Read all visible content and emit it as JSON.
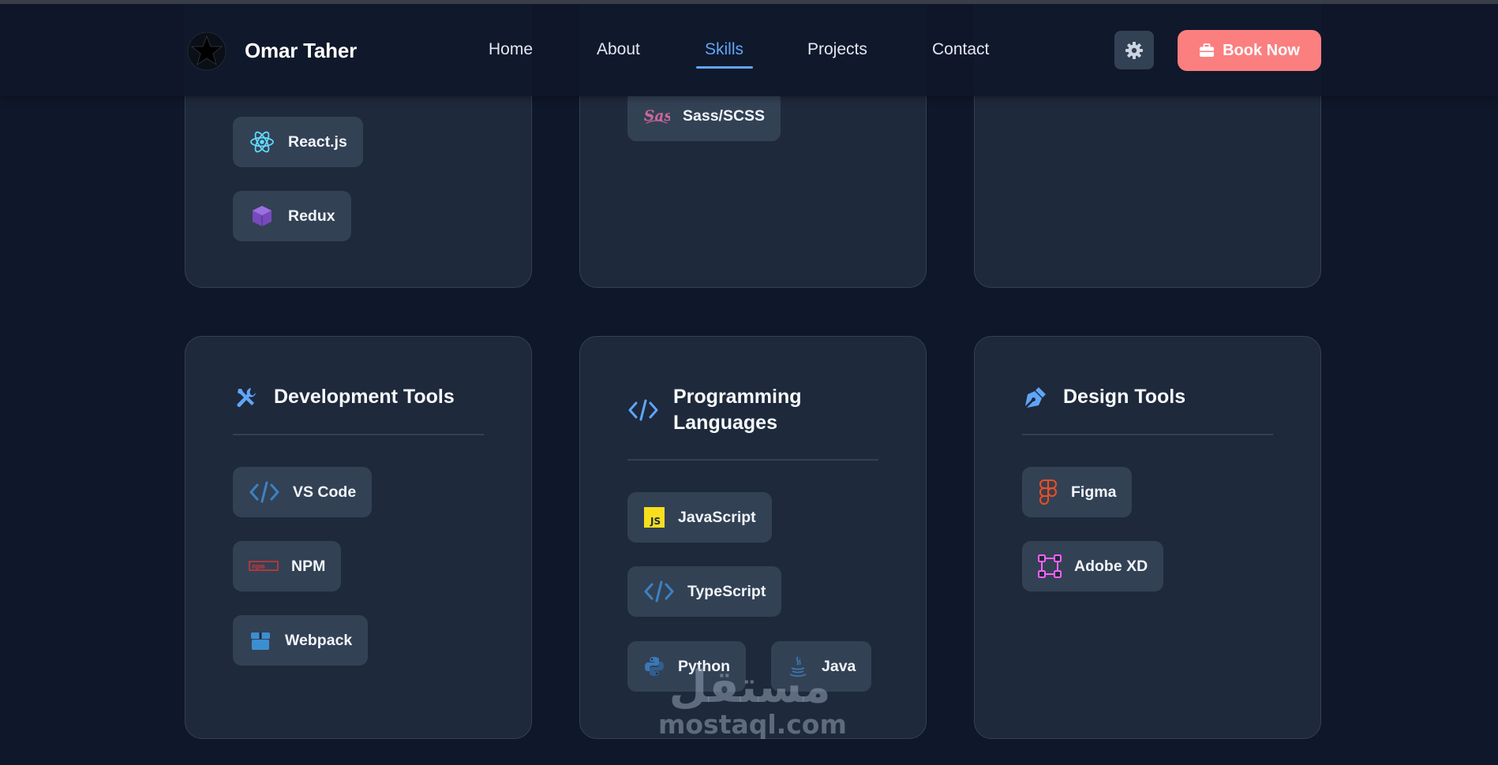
{
  "nav": {
    "brand": "Omar Taher",
    "links": [
      "Home",
      "About",
      "Skills",
      "Projects",
      "Contact"
    ],
    "active_link": "Skills",
    "theme_icon": "gear-icon",
    "book_label": "Book Now",
    "book_icon": "briefcase-icon"
  },
  "top_cards": {
    "left": {
      "skills": [
        {
          "name": "React.js",
          "icon": "react-icon"
        },
        {
          "name": "Redux",
          "icon": "redux-icon"
        }
      ]
    },
    "middle": {
      "skills": [
        {
          "name": "Sass/SCSS",
          "icon": "sass-icon"
        }
      ]
    },
    "right": {
      "skills": []
    }
  },
  "cards": [
    {
      "title": "Development Tools",
      "icon": "tools-icon",
      "skills": [
        {
          "name": "VS Code",
          "icon": "code-icon"
        },
        {
          "name": "NPM",
          "icon": "npm-icon"
        },
        {
          "name": "Webpack",
          "icon": "box-icon"
        }
      ]
    },
    {
      "title": "Programming Languages",
      "title_line1": "Programming",
      "title_line2": "Languages",
      "icon": "code-icon",
      "skills": [
        {
          "name": "JavaScript",
          "icon": "javascript-icon"
        },
        {
          "name": "TypeScript",
          "icon": "code-icon"
        },
        {
          "name": "Python",
          "icon": "python-icon"
        },
        {
          "name": "Java",
          "icon": "java-icon"
        }
      ]
    },
    {
      "title": "Design Tools",
      "icon": "pen-icon",
      "skills": [
        {
          "name": "Figma",
          "icon": "figma-icon"
        },
        {
          "name": "Adobe XD",
          "icon": "vector-square-icon"
        }
      ]
    }
  ],
  "watermark": {
    "arabic": "مستقل",
    "latin": "mostaql.com"
  },
  "colors": {
    "background": "#0f172a",
    "card": "#1e293b",
    "pill": "#334155",
    "accent": "#60a5fa",
    "book_button": "#fb7f7f"
  }
}
